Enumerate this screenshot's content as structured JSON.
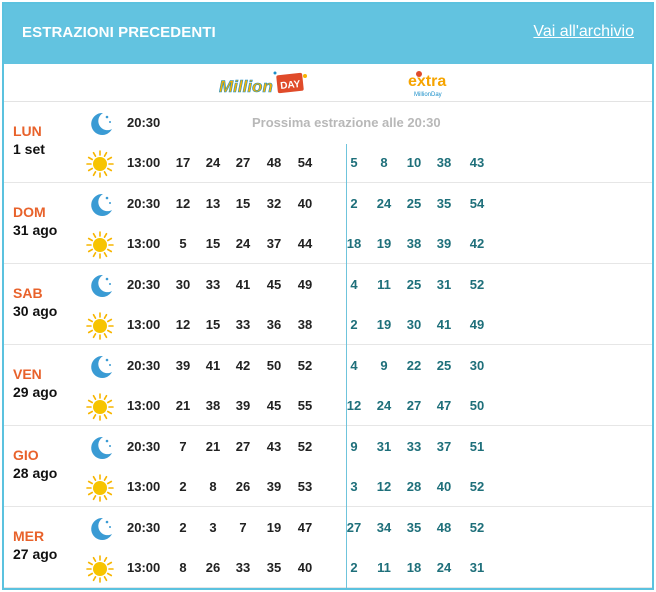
{
  "header": {
    "title": "ESTRAZIONI PRECEDENTI",
    "archive_link": "Vai all'archivio"
  },
  "logos": {
    "millionday": {
      "word1": "Million",
      "word2": "DAY"
    },
    "extra": {
      "word": "extra",
      "sub": "MillionDay"
    }
  },
  "colors": {
    "accent": "#62c3e0",
    "day_name": "#e8622b",
    "extra_numbers": "#1e6f7a",
    "next_draw_text": "#b8b8b8"
  },
  "icons": {
    "evening": "moon-icon",
    "midday": "sun-icon"
  },
  "days": [
    {
      "name": "LUN",
      "date": "1 set",
      "draws": [
        {
          "time": "20:30",
          "icon": "moon-icon",
          "pending_text": "Prossima estrazione alle 20:30",
          "numbers": [],
          "extra": []
        },
        {
          "time": "13:00",
          "icon": "sun-icon",
          "numbers": [
            "17",
            "24",
            "27",
            "48",
            "54"
          ],
          "extra": [
            "5",
            "8",
            "10",
            "38",
            "43"
          ]
        }
      ]
    },
    {
      "name": "DOM",
      "date": "31 ago",
      "draws": [
        {
          "time": "20:30",
          "icon": "moon-icon",
          "numbers": [
            "12",
            "13",
            "15",
            "32",
            "40"
          ],
          "extra": [
            "2",
            "24",
            "25",
            "35",
            "54"
          ]
        },
        {
          "time": "13:00",
          "icon": "sun-icon",
          "numbers": [
            "5",
            "15",
            "24",
            "37",
            "44"
          ],
          "extra": [
            "18",
            "19",
            "38",
            "39",
            "42"
          ]
        }
      ]
    },
    {
      "name": "SAB",
      "date": "30 ago",
      "draws": [
        {
          "time": "20:30",
          "icon": "moon-icon",
          "numbers": [
            "30",
            "33",
            "41",
            "45",
            "49"
          ],
          "extra": [
            "4",
            "11",
            "25",
            "31",
            "52"
          ]
        },
        {
          "time": "13:00",
          "icon": "sun-icon",
          "numbers": [
            "12",
            "15",
            "33",
            "36",
            "38"
          ],
          "extra": [
            "2",
            "19",
            "30",
            "41",
            "49"
          ]
        }
      ]
    },
    {
      "name": "VEN",
      "date": "29 ago",
      "draws": [
        {
          "time": "20:30",
          "icon": "moon-icon",
          "numbers": [
            "39",
            "41",
            "42",
            "50",
            "52"
          ],
          "extra": [
            "4",
            "9",
            "22",
            "25",
            "30"
          ]
        },
        {
          "time": "13:00",
          "icon": "sun-icon",
          "numbers": [
            "21",
            "38",
            "39",
            "45",
            "55"
          ],
          "extra": [
            "12",
            "24",
            "27",
            "47",
            "50"
          ]
        }
      ]
    },
    {
      "name": "GIO",
      "date": "28 ago",
      "draws": [
        {
          "time": "20:30",
          "icon": "moon-icon",
          "numbers": [
            "7",
            "21",
            "27",
            "43",
            "52"
          ],
          "extra": [
            "9",
            "31",
            "33",
            "37",
            "51"
          ]
        },
        {
          "time": "13:00",
          "icon": "sun-icon",
          "numbers": [
            "2",
            "8",
            "26",
            "39",
            "53"
          ],
          "extra": [
            "3",
            "12",
            "28",
            "40",
            "52"
          ]
        }
      ]
    },
    {
      "name": "MER",
      "date": "27 ago",
      "draws": [
        {
          "time": "20:30",
          "icon": "moon-icon",
          "numbers": [
            "2",
            "3",
            "7",
            "19",
            "47"
          ],
          "extra": [
            "27",
            "34",
            "35",
            "48",
            "52"
          ]
        },
        {
          "time": "13:00",
          "icon": "sun-icon",
          "numbers": [
            "8",
            "26",
            "33",
            "35",
            "40"
          ],
          "extra": [
            "2",
            "11",
            "18",
            "24",
            "31"
          ]
        }
      ]
    }
  ]
}
